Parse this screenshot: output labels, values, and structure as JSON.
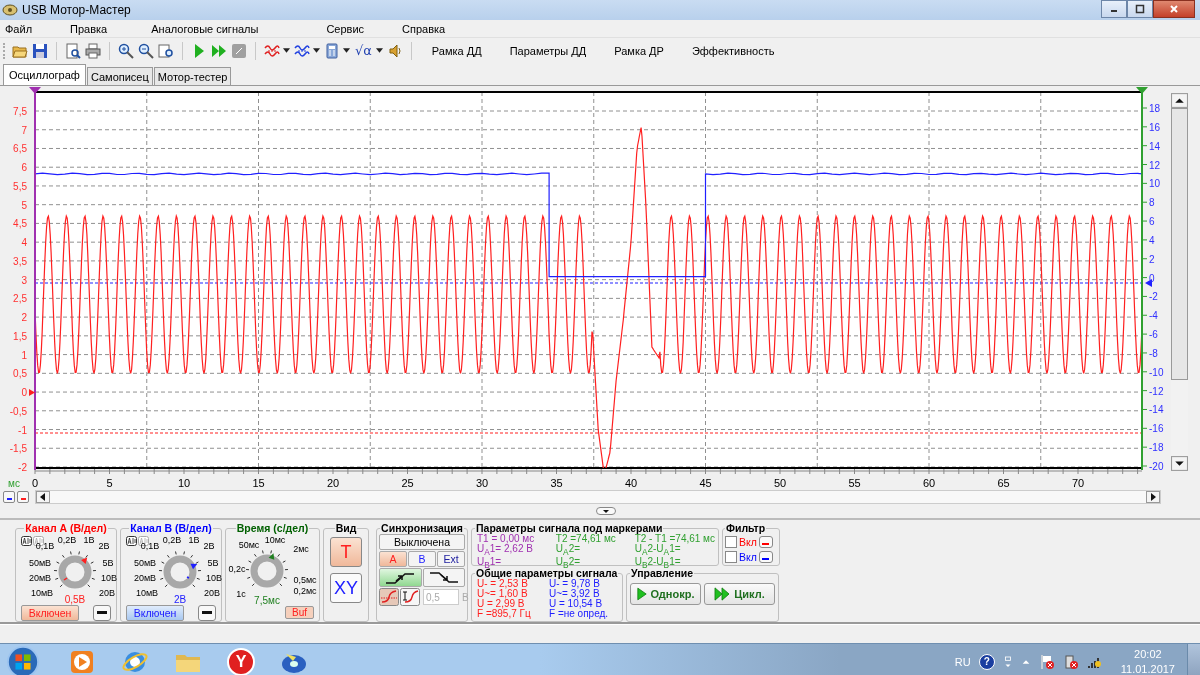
{
  "window": {
    "title": "USB Мотор-Мастер"
  },
  "menu": [
    "Файл",
    "Правка",
    "Аналоговые сигналы",
    "Сервис",
    "Справка"
  ],
  "toolbar": {
    "formula": "√α",
    "text_buttons": [
      "Рамка ДД",
      "Параметры ДД",
      "Рамка ДР",
      "Эффективность"
    ]
  },
  "tabs": [
    {
      "label": "Осциллограф",
      "selected": true
    },
    {
      "label": "Самописец",
      "selected": false
    },
    {
      "label": "Мотор-тестер",
      "selected": false
    }
  ],
  "plot": {
    "x_unit": "мс",
    "x_ticks": [
      "0",
      "5",
      "10",
      "15",
      "20",
      "25",
      "30",
      "35",
      "40",
      "45",
      "50",
      "55",
      "60",
      "65",
      "70"
    ],
    "left_ticks": [
      "7,5",
      "7",
      "6,5",
      "6",
      "5,5",
      "5",
      "4,5",
      "4",
      "3,5",
      "3",
      "2,5",
      "2",
      "1,5",
      "1",
      "0,5",
      "0",
      "-0,5",
      "-1",
      "-1,5",
      "-2"
    ],
    "right_ticks": [
      "18",
      "16",
      "14",
      "12",
      "10",
      "8",
      "6",
      "4",
      "2",
      "0",
      "-2",
      "-4",
      "-6",
      "-8",
      "-10",
      "-12",
      "-14",
      "-16",
      "-18",
      "-20"
    ]
  },
  "channel_a": {
    "title": "Канал А (В/дел)",
    "scale": [
      "0,2В",
      "1В",
      "0,1В",
      "2В",
      "50мВ",
      "5В",
      "20мВ",
      "10В",
      "10мВ",
      "20В"
    ],
    "value": "0,5В",
    "button": "Включен",
    "enabled": true
  },
  "channel_b": {
    "title": "Канал B (В/дел)",
    "scale": [
      "0,2В",
      "1В",
      "0,1В",
      "2В",
      "50мВ",
      "5В",
      "20мВ",
      "10В",
      "10мВ",
      "20В"
    ],
    "value": "2В",
    "button": "Включен",
    "enabled": true
  },
  "timebase": {
    "title": "Время (с/дел)",
    "scale": [
      "50мс",
      "10мс",
      "2мс",
      "0,2с",
      "0,5мс",
      "1с",
      "0,2мс"
    ],
    "value": "7,5мс",
    "button": "Buf"
  },
  "view": {
    "title": "Вид",
    "buttons": [
      {
        "label": "T",
        "selected": true
      },
      {
        "label": "XY",
        "selected": false
      }
    ]
  },
  "sync": {
    "title": "Синхронизация",
    "mode": "Выключена",
    "sources": [
      {
        "label": "A",
        "selected": true
      },
      {
        "label": "B",
        "selected": false
      },
      {
        "label": "Ext",
        "selected": false
      }
    ],
    "edges": [
      {
        "kind": "rising",
        "selected": true
      },
      {
        "kind": "falling",
        "selected": false
      }
    ],
    "level": "0,5",
    "unit": "В"
  },
  "marker_params": {
    "title": "Параметры сигнала под маркерами",
    "columns": [
      {
        "color": "#a030b0",
        "lines": [
          "T1 = 0,00 мс",
          "U$_{A}$1= 2,62 В",
          "U$_{B}$1="
        ]
      },
      {
        "color": "#30a030",
        "lines": [
          "T2 =74,61 мс",
          "U$_{A}$2=",
          "U$_{B}$2="
        ]
      },
      {
        "color": "#30a030",
        "lines": [
          "T2 - T1 =74,61 мс",
          "U$_{A}$2-U$_{A}$1=",
          "U$_{B}$2-U$_{B}$1="
        ]
      }
    ]
  },
  "filter": {
    "title": "Фильтр",
    "items": [
      {
        "label": "Вкл",
        "checked": false,
        "color": "#ff0000"
      },
      {
        "label": "Вкл",
        "checked": false,
        "color": "#0000ff"
      }
    ]
  },
  "general_params": {
    "title": "Общие параметры сигнала",
    "columns": [
      {
        "color": "#ff2020",
        "lines": [
          "U- = 2,53 В",
          "U~= 1,60 В",
          "U = 2,99 В",
          "F =895,7 Гц"
        ]
      },
      {
        "color": "#2020ff",
        "lines": [
          "U- = 9,78 В",
          "U~= 3,92 В",
          "U = 10,54 В",
          "F =не опред."
        ]
      }
    ]
  },
  "control": {
    "title": "Управление",
    "buttons": [
      {
        "kind": "single",
        "label": "Однокр."
      },
      {
        "kind": "cycle",
        "label": "Цикл."
      }
    ]
  },
  "taskbar": {
    "apps": [
      {
        "kind": "media"
      },
      {
        "kind": "browser"
      },
      {
        "kind": "folder"
      },
      {
        "kind": "letter",
        "label": "Y"
      },
      {
        "kind": "disc"
      }
    ],
    "language": "RU",
    "help": "?",
    "time": "20:02",
    "date": "11.01.2017"
  }
}
